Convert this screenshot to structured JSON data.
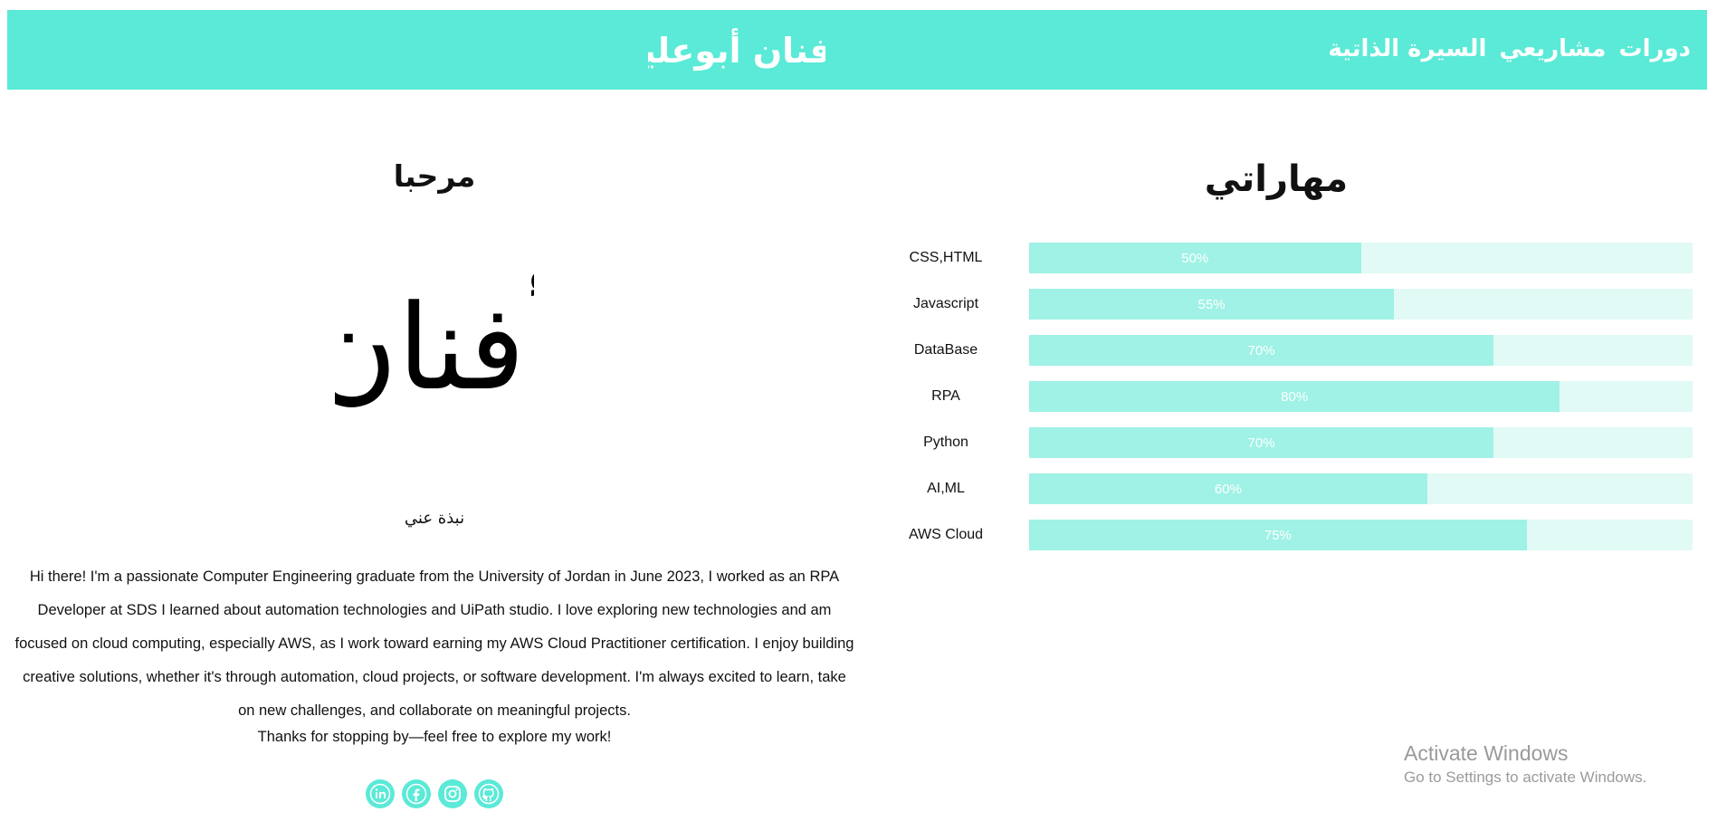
{
  "header": {
    "logo_text": "أفنان أبوعليا",
    "nav": [
      {
        "label": "السيرة الذاتية"
      },
      {
        "label": "مشاريعي"
      },
      {
        "label": "دورات"
      }
    ]
  },
  "intro": {
    "heading": "مرحبا",
    "signature_name": "أفنان",
    "about_title": "نبذة عني",
    "bio": "Hi there! I'm a passionate Computer Engineering graduate from the University of Jordan in June 2023, I worked as an RPA Developer at SDS I learned about automation technologies and UiPath studio. I love exploring new technologies and am focused on cloud computing, especially AWS, as I work toward earning my AWS Cloud Practitioner certification. I enjoy building creative solutions, whether it's through automation, cloud projects, or software development. I'm always excited to learn, take on new challenges, and collaborate on meaningful projects.",
    "thanks": "Thanks for stopping by—feel free to explore my work!"
  },
  "social": [
    {
      "icon": "linkedin-icon"
    },
    {
      "icon": "facebook-icon"
    },
    {
      "icon": "instagram-icon"
    },
    {
      "icon": "github-icon"
    }
  ],
  "skills": {
    "heading": "مهاراتي",
    "items": [
      {
        "name": "CSS,HTML",
        "percent": 50,
        "percent_label": "50%"
      },
      {
        "name": "Javascript",
        "percent": 55,
        "percent_label": "55%"
      },
      {
        "name": "DataBase",
        "percent": 70,
        "percent_label": "70%"
      },
      {
        "name": "RPA",
        "percent": 80,
        "percent_label": "80%"
      },
      {
        "name": "Python",
        "percent": 70,
        "percent_label": "70%"
      },
      {
        "name": "AI,ML",
        "percent": 60,
        "percent_label": "60%"
      },
      {
        "name": "AWS Cloud",
        "percent": 75,
        "percent_label": "75%"
      }
    ]
  },
  "watermark": {
    "title": "Activate Windows",
    "subtitle": "Go to Settings to activate Windows."
  },
  "colors": {
    "accent": "#5aead7",
    "bar_fill": "#9ff2e5",
    "bar_track": "#e1faf6"
  }
}
